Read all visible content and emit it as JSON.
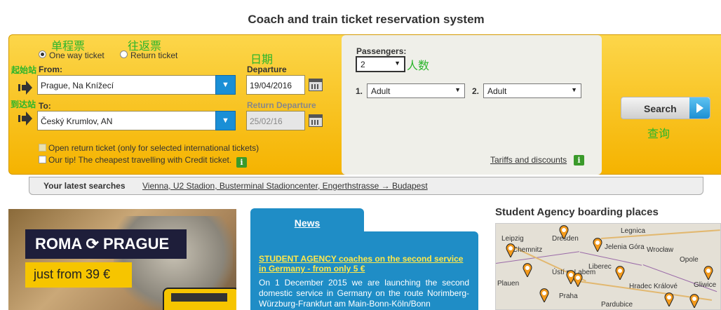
{
  "page": {
    "title": "Coach and train ticket reservation system"
  },
  "annotations": {
    "one_way_cn": "单程票",
    "return_cn": "往返票",
    "date_cn": "日期",
    "passengers_cn": "人数",
    "from_cn": "起始站",
    "to_cn": "到达站",
    "search_cn": "查询"
  },
  "form": {
    "one_way_label": "One way ticket",
    "return_label": "Return ticket",
    "from_label": "From:",
    "from_value": "Prague, Na Knížecí",
    "to_label": "To:",
    "to_value": "Český Krumlov, AN",
    "departure_label": "Departure",
    "departure_value": "19/04/2016",
    "return_departure_label": "Return Departure",
    "return_departure_value": "25/02/16",
    "open_return_label": "Open return ticket (only for selected international tickets)",
    "tip_label": "Our tip! The cheapest travelling with Credit ticket.",
    "info_icon": "i"
  },
  "passengers": {
    "label": "Passengers:",
    "count": "2",
    "p1_num": "1.",
    "p1_type": "Adult",
    "p2_num": "2.",
    "p2_type": "Adult",
    "tariffs_link": "Tariffs and discounts"
  },
  "search": {
    "label": "Search"
  },
  "latest": {
    "label": "Your latest searches",
    "item": "Vienna, U2 Stadion, Busterminal Stadioncenter, Engerthstrasse → Budapest"
  },
  "banner": {
    "line1": "ROMA ⟳ PRAGUE",
    "line2": "just from 39 €"
  },
  "news": {
    "tab": "News",
    "headline": "STUDENT AGENCY coaches on the second service in Germany - from only 5 €",
    "body": "On 1 December 2015 we are launching the second domestic service in Germany on the route Norimberg-Würzburg-Frankfurt am Main-Bonn-Köln/Bonn"
  },
  "map": {
    "title": "Student Agency boarding places",
    "cities": [
      "Legnica",
      "Leipzig",
      "Dresden",
      "Chemnitz",
      "Jelenia Góra",
      "Wrocław",
      "Liberec",
      "Opole",
      "Ústí n. Labem",
      "Hradec Králové",
      "Plauen",
      "Praha",
      "Pardubice",
      "Gliwice"
    ]
  },
  "colors": {
    "panel": "#f5b300",
    "accent_blue": "#1d8fd2",
    "annotation_green": "#2bb52b"
  }
}
